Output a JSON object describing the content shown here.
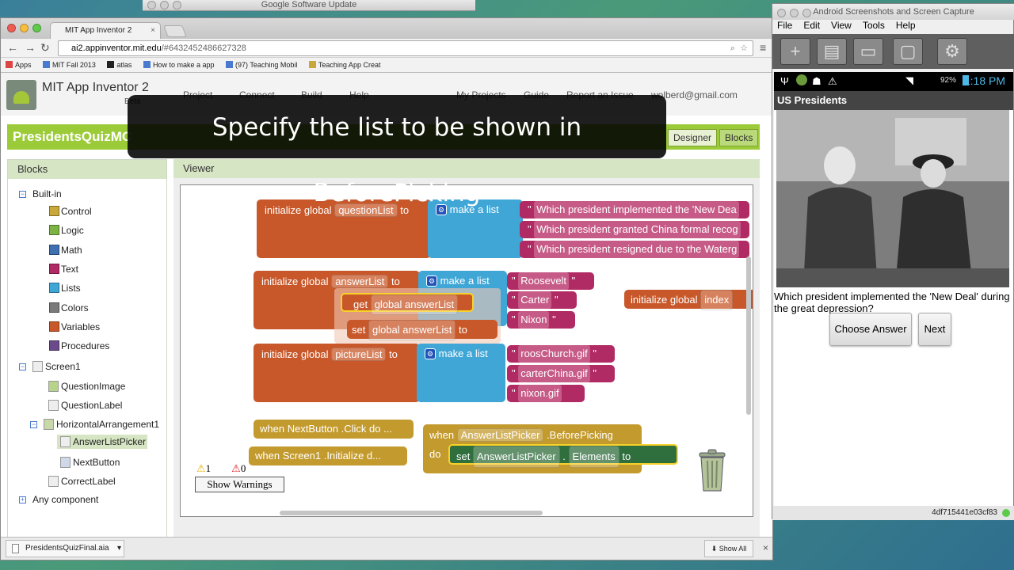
{
  "background_window": {
    "title": "Google Software Update"
  },
  "browser": {
    "tab": "MIT App Inventor 2",
    "url_host": "ai2.appinventor.mit.edu",
    "url_rest": "/#6432452486627328",
    "bookmarks": [
      "Apps",
      "MIT Fall 2013",
      "atlas",
      "How to make a app",
      "(97) Teaching Mobil",
      "Teaching App Creat"
    ]
  },
  "app": {
    "title": "MIT App Inventor 2",
    "beta": "Beta",
    "menu": [
      "Project",
      "Connect",
      "Build",
      "Help",
      "My Projects",
      "Guide",
      "Report an Issue",
      "wolberd@gmail.com"
    ],
    "project_name": "PresidentsQuizMC",
    "designer": "Designer",
    "blocks": "Blocks"
  },
  "caption": "Specify the list to be shown in BeforePicking",
  "blocks_panel": {
    "heading": "Blocks",
    "builtin": "Built-in",
    "builtin_items": [
      {
        "label": "Control",
        "color": "#c8a83a"
      },
      {
        "label": "Logic",
        "color": "#7cb342"
      },
      {
        "label": "Math",
        "color": "#3f6fb0"
      },
      {
        "label": "Text",
        "color": "#b02a63"
      },
      {
        "label": "Lists",
        "color": "#3fa6d6"
      },
      {
        "label": "Colors",
        "color": "#7a7a7a"
      },
      {
        "label": "Variables",
        "color": "#c8582a"
      },
      {
        "label": "Procedures",
        "color": "#6a4a8a"
      }
    ],
    "screen": "Screen1",
    "components": [
      "QuestionImage",
      "QuestionLabel",
      "HorizontalArrangement1",
      "AnswerListPicker",
      "NextButton",
      "CorrectLabel"
    ],
    "any": "Any component"
  },
  "viewer": {
    "heading": "Viewer",
    "init": "initialize global",
    "to": "to",
    "make_list": "make a list",
    "qlist": "questionList",
    "questions": [
      "Which president implemented the 'New Dea",
      "Which president granted China formal recog",
      "Which president resigned due to the Waterg"
    ],
    "alist": "answerList",
    "answers": [
      "Roosevelt",
      "Carter",
      "Nixon"
    ],
    "get": "get",
    "set": "set",
    "global_alist": "global answerList",
    "plist": "pictureList",
    "pictures": [
      "roosChurch.gif",
      "carterChina.gif",
      "nixon.gif"
    ],
    "index": "index",
    "when": "when",
    "next_click": "NextButton .Click do ...",
    "screen_init_a": "Screen1 .Initialize d...",
    "picker": "AnswerListPicker",
    "before": ".BeforePicking",
    "do": "do",
    "elements": "Elements",
    "dot": ".",
    "warn_count": "1",
    "err_count": "0",
    "show_warnings": "Show Warnings"
  },
  "download": {
    "file": "PresidentsQuizFinal.aia",
    "show_all": "Show All"
  },
  "android": {
    "window_title": "Android Screenshots and Screen Capture",
    "menu": [
      "File",
      "Edit",
      "View",
      "Tools",
      "Help"
    ],
    "battery": "92%",
    "time": "1:18 PM",
    "app_title": "US Presidents",
    "question": "Which president implemented the 'New Deal' during the great depression?",
    "choose": "Choose Answer",
    "next": "Next",
    "device_id": "4df715441e03cf83"
  }
}
